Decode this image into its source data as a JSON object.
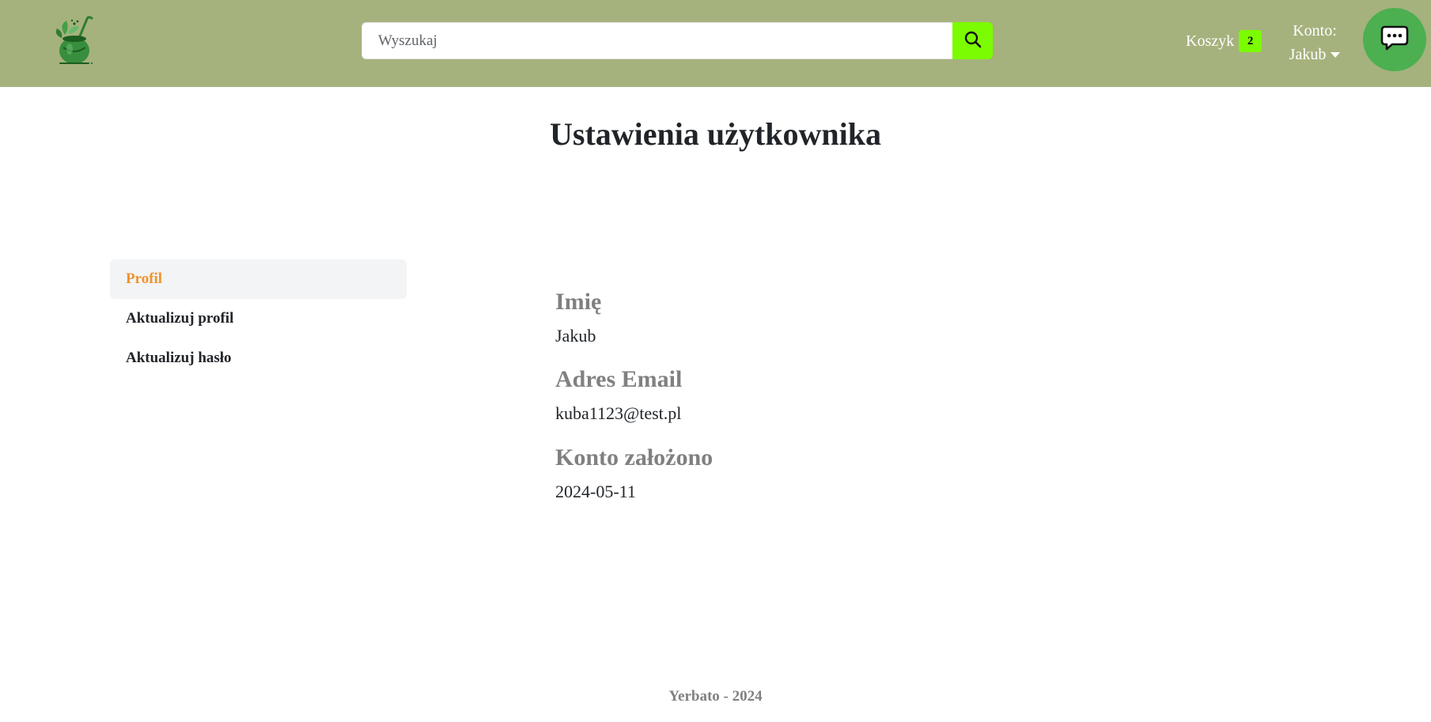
{
  "header": {
    "search": {
      "placeholder": "Wyszukaj",
      "value": ""
    },
    "cart": {
      "label": "Koszyk",
      "count": "2"
    },
    "account": {
      "label": "Konto:",
      "user": "Jakub"
    },
    "colors": {
      "navbar_bg": "#a5b27d",
      "accent_green": "#7cfc00",
      "chat_button": "#4caf50"
    },
    "icons": {
      "logo": "yerba-mate-cup-logo",
      "search": "search-icon",
      "chat": "chat-bubble-icon",
      "dropdown": "caret-down-icon"
    }
  },
  "page": {
    "title": "Ustawienia użytkownika"
  },
  "sidebar": {
    "items": [
      {
        "label": "Profil",
        "active": true
      },
      {
        "label": "Aktualizuj profil",
        "active": false
      },
      {
        "label": "Aktualizuj hasło",
        "active": false
      }
    ],
    "active_color": "#f0932b"
  },
  "profile": {
    "fields": [
      {
        "label": "Imię",
        "value": "Jakub"
      },
      {
        "label": "Adres Email",
        "value": "kuba1123@test.pl"
      },
      {
        "label": "Konto założono",
        "value": "2024-05-11"
      }
    ]
  },
  "footer": {
    "text": "Yerbato - 2024"
  }
}
